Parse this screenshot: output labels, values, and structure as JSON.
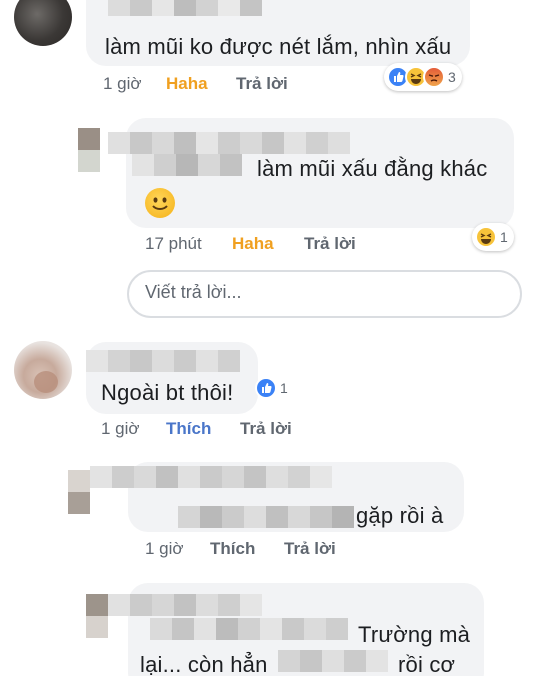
{
  "comments": [
    {
      "text": "làm mũi ko được nét lắm, nhìn xấu",
      "time": "1 giờ",
      "reaction_label": "Haha",
      "reply_label": "Trả lời",
      "reaction_icons": [
        "like-icon",
        "haha-icon",
        "angry-icon"
      ],
      "reaction_count": "3"
    },
    {
      "text": "làm mũi xấu đằng khác",
      "emoji": "smile-emoji",
      "time": "17 phút",
      "reaction_label": "Haha",
      "reply_label": "Trả lời",
      "reaction_icons": [
        "haha-icon"
      ],
      "reaction_count": "1"
    },
    {
      "text": "Ngoài bt thôi!",
      "time": "1 giờ",
      "reaction_label": "Thích",
      "reply_label": "Trả lời",
      "reaction_icons": [
        "like-icon"
      ],
      "reaction_count": "1"
    },
    {
      "text": "gặp rồi à",
      "time": "1 giờ",
      "reaction_label": "Thích",
      "reply_label": "Trả lời"
    },
    {
      "text_line1": "Trường mà",
      "text_line2_a": "lại... còn hẳn",
      "text_line2_b": "rồi cơ"
    }
  ],
  "reply_box": {
    "placeholder": "Viết trả lời..."
  },
  "colors": {
    "bubble_bg": "#f2f3f5",
    "meta_text": "#606770",
    "haha_accent": "#f0a020",
    "like_accent": "#4a76c9",
    "blur_tones": [
      "#d6d6d6",
      "#c2c2c2",
      "#e4e4e4",
      "#b0b0b0",
      "#cfcfcf"
    ]
  }
}
